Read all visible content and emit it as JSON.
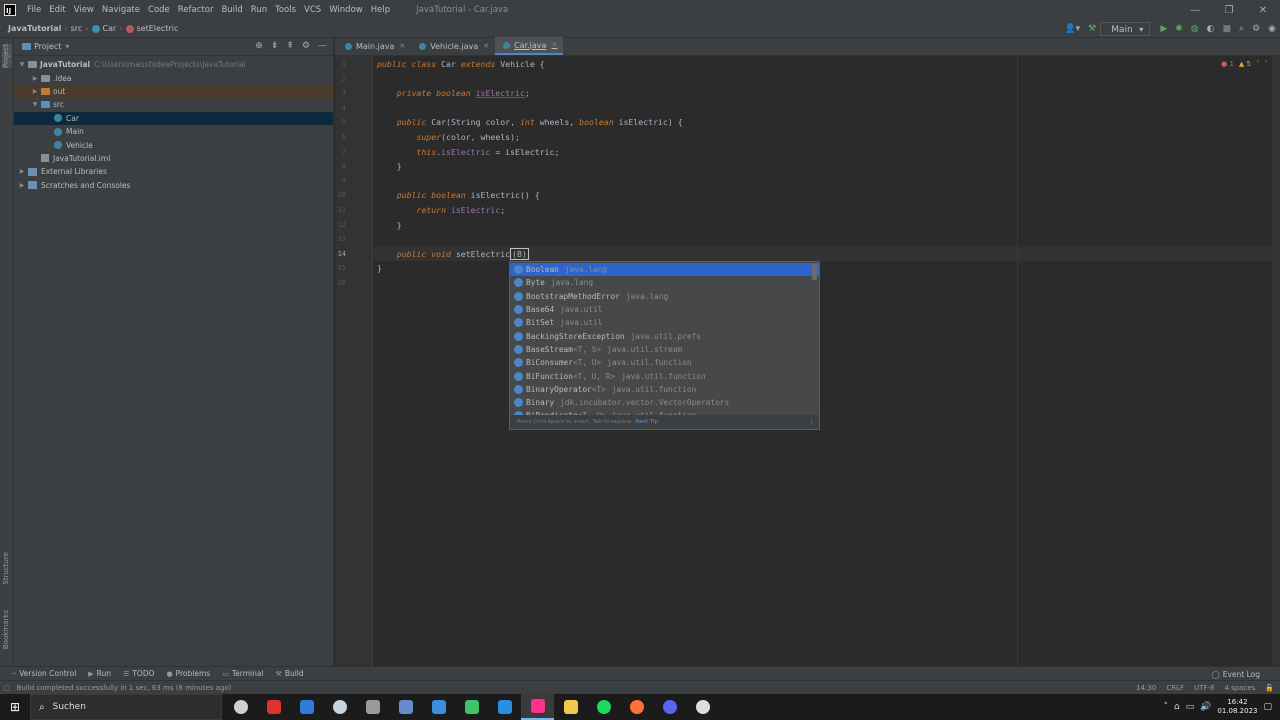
{
  "titlebar": {
    "menu": [
      "File",
      "Edit",
      "View",
      "Navigate",
      "Code",
      "Refactor",
      "Build",
      "Run",
      "Tools",
      "VCS",
      "Window",
      "Help"
    ],
    "title": "JavaTutorial - Car.java"
  },
  "navbar": {
    "project": "JavaTutorial",
    "folder": "src",
    "class": "Car",
    "method": "setElectric",
    "run_config": "Main"
  },
  "left_strip": {
    "project": "Project",
    "structure": "Structure",
    "bookmarks": "Bookmarks"
  },
  "project_panel": {
    "title": "Project",
    "tree": [
      {
        "label": "JavaTutorial",
        "path": "C:\\Users\\maust\\IdeaProjects\\JavaTutorial",
        "depth": 0,
        "icon": "folder",
        "expanded": true,
        "bold": true
      },
      {
        "label": ".idea",
        "depth": 1,
        "icon": "folder",
        "expanded": false
      },
      {
        "label": "out",
        "depth": 1,
        "icon": "folder-orange",
        "expanded": false
      },
      {
        "label": "src",
        "depth": 1,
        "icon": "folder-blue",
        "expanded": true
      },
      {
        "label": "Car",
        "depth": 2,
        "icon": "class",
        "selected": true
      },
      {
        "label": "Main",
        "depth": 2,
        "icon": "class"
      },
      {
        "label": "Vehicle",
        "depth": 2,
        "icon": "class"
      },
      {
        "label": "JavaTutorial.iml",
        "depth": 1,
        "icon": "iml"
      },
      {
        "label": "External Libraries",
        "depth": 0,
        "icon": "lib",
        "expanded": false
      },
      {
        "label": "Scratches and Consoles",
        "depth": 0,
        "icon": "lib",
        "expanded": false
      }
    ]
  },
  "tabs": [
    {
      "label": "Main.java",
      "active": false
    },
    {
      "label": "Vehicle.java",
      "active": false
    },
    {
      "label": "Car.java",
      "active": true
    }
  ],
  "inspections": {
    "errors": "1",
    "warnings": "5"
  },
  "editor": {
    "line_numbers": [
      "1",
      "2",
      "3",
      "4",
      "5",
      "6",
      "7",
      "8",
      "9",
      "10",
      "11",
      "12",
      "13",
      "14",
      "15",
      "16"
    ],
    "lines": [
      [
        {
          "t": "public class ",
          "c": "kw"
        },
        {
          "t": "Car ",
          "c": ""
        },
        {
          "t": "extends ",
          "c": "kw"
        },
        {
          "t": "Vehicle {",
          "c": ""
        }
      ],
      [],
      [
        {
          "t": "    private boolean ",
          "c": "kw"
        },
        {
          "t": "isElectric",
          "c": "fld und"
        },
        {
          "t": ";",
          "c": ""
        }
      ],
      [],
      [
        {
          "t": "    public ",
          "c": "kw"
        },
        {
          "t": "Car(String color, ",
          "c": ""
        },
        {
          "t": "int ",
          "c": "kw"
        },
        {
          "t": "wheels, ",
          "c": ""
        },
        {
          "t": "boolean ",
          "c": "kw"
        },
        {
          "t": "isElectric) {",
          "c": ""
        }
      ],
      [
        {
          "t": "        super",
          "c": "kw"
        },
        {
          "t": "(color, wheels);",
          "c": ""
        }
      ],
      [
        {
          "t": "        this",
          "c": "kw"
        },
        {
          "t": ".",
          "c": ""
        },
        {
          "t": "isElectric",
          "c": "fld"
        },
        {
          "t": " = isElectric;",
          "c": ""
        }
      ],
      [
        {
          "t": "    }",
          "c": ""
        }
      ],
      [],
      [
        {
          "t": "    public boolean ",
          "c": "kw"
        },
        {
          "t": "isElectric() {",
          "c": ""
        }
      ],
      [
        {
          "t": "        return ",
          "c": "kw"
        },
        {
          "t": "isElectric",
          "c": "fld"
        },
        {
          "t": ";",
          "c": ""
        }
      ],
      [
        {
          "t": "    }",
          "c": ""
        }
      ],
      [],
      [
        {
          "t": "    public void ",
          "c": "kw"
        },
        {
          "t": "setElectric",
          "c": ""
        },
        {
          "t": "(B)",
          "c": "cursor"
        }
      ],
      [
        {
          "t": "}",
          "c": ""
        }
      ],
      []
    ],
    "current_line": 13
  },
  "completion": {
    "items": [
      {
        "name": "Boolean",
        "generic": "",
        "pkg": "java.lang"
      },
      {
        "name": "Byte",
        "generic": "",
        "pkg": "java.lang"
      },
      {
        "name": "BootstrapMethodError",
        "generic": "",
        "pkg": "java.lang"
      },
      {
        "name": "Base64",
        "generic": "",
        "pkg": "java.util"
      },
      {
        "name": "BitSet",
        "generic": "",
        "pkg": "java.util"
      },
      {
        "name": "BackingStoreException",
        "generic": "",
        "pkg": "java.util.prefs"
      },
      {
        "name": "BaseStream",
        "generic": "<T, S>",
        "pkg": "java.util.stream"
      },
      {
        "name": "BiConsumer",
        "generic": "<T, U>",
        "pkg": "java.util.function"
      },
      {
        "name": "BiFunction",
        "generic": "<T, U, R>",
        "pkg": "java.util.function"
      },
      {
        "name": "BinaryOperator",
        "generic": "<T>",
        "pkg": "java.util.function"
      },
      {
        "name": "Binary",
        "generic": "",
        "pkg": "jdk.incubator.vector.VectorOperators"
      },
      {
        "name": "BiPredicate",
        "generic": "<T, U>",
        "pkg": "java.util.function"
      }
    ],
    "selected": 0,
    "footer": "Press Ctrl+Space to insert, Tab to replace",
    "footer_link": "Next Tip"
  },
  "bottom_tools": [
    "Version Control",
    "Run",
    "TODO",
    "Problems",
    "Terminal",
    "Build"
  ],
  "event_log": "Event Log",
  "status": {
    "message": "Build completed successfully in 1 sec, 63 ms (8 minutes ago)",
    "position": "14:30",
    "line_sep": "CRLF",
    "encoding": "UTF-8",
    "indent": "4 spaces"
  },
  "taskbar": {
    "search_placeholder": "Suchen",
    "time": "16:42",
    "date": "01.08.2023",
    "apps": [
      {
        "name": "task-view",
        "color": "#cfcfcf"
      },
      {
        "name": "opera",
        "color": "#e0332e"
      },
      {
        "name": "app-blue",
        "color": "#2f7dd8"
      },
      {
        "name": "steam",
        "color": "#c6d4df"
      },
      {
        "name": "app-dark",
        "color": "#9a9a9a"
      },
      {
        "name": "app-box",
        "color": "#6a8ad0"
      },
      {
        "name": "app-check",
        "color": "#3b8de0"
      },
      {
        "name": "app-green",
        "color": "#3ec26a"
      },
      {
        "name": "vscode",
        "color": "#2a8fe0"
      },
      {
        "name": "intellij",
        "color": "#ff318c"
      },
      {
        "name": "explorer",
        "color": "#f2c94c"
      },
      {
        "name": "spotify",
        "color": "#1ed760"
      },
      {
        "name": "firefox",
        "color": "#ff7139"
      },
      {
        "name": "discord",
        "color": "#5865f2"
      },
      {
        "name": "chrome",
        "color": "#dddddd"
      }
    ],
    "active_app": 9
  }
}
